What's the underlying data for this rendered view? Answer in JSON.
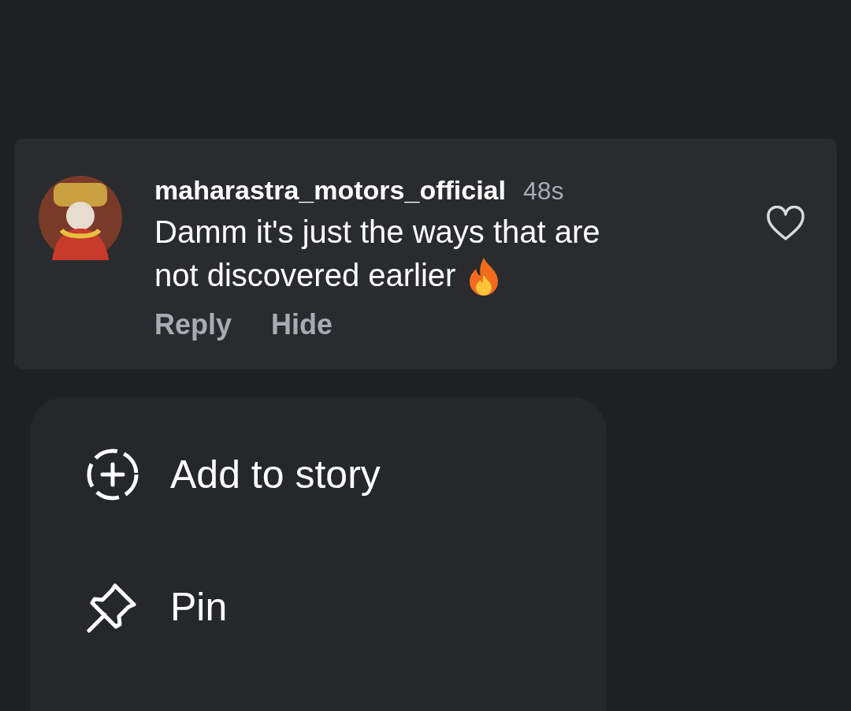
{
  "comment": {
    "username": "maharastra_motors_official",
    "time": "48s",
    "text_lines": [
      "Damm it's just the ways that are",
      "not discovered earlier"
    ],
    "liked": false,
    "actions": [
      "Reply",
      "Hide"
    ]
  },
  "menu": {
    "items": [
      {
        "kind": "add-story",
        "label": "Add to story"
      },
      {
        "kind": "pin",
        "label": "Pin"
      }
    ]
  }
}
